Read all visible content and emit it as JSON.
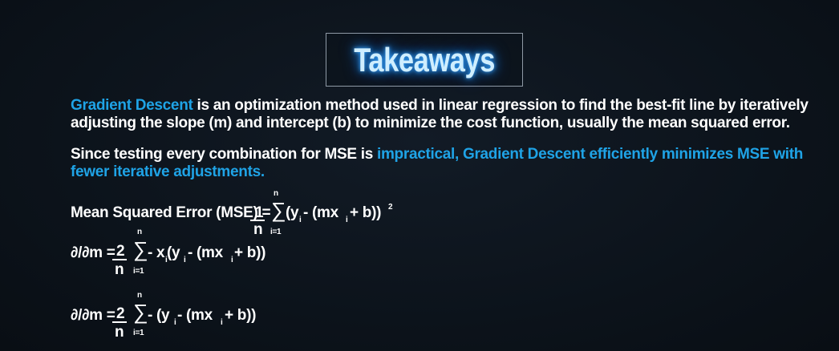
{
  "title": "Takeaways",
  "para1": {
    "highlight": "Gradient Descent",
    "rest": " is an optimization method used in linear regression to find the best-fit line by iteratively adjusting the slope (m) and intercept (b) to minimize the cost function, usually the mean squared error."
  },
  "para2": {
    "lead": "Since testing every combination for MSE is ",
    "highlight": "impractical, Gradient Descent efficiently minimizes MSE with fewer iterative adjustments."
  },
  "mse": {
    "label": "Mean Squared Error (MSE) =",
    "numerator": "1",
    "denominator": "n",
    "sum_top": "n",
    "sum_bottom": "i=1",
    "sigma": "∑",
    "body_open": "(y",
    "sub_i1": "i",
    "body_mid": " - (mx",
    "sub_i2": "i",
    "body_close": " + b))",
    "power": "2"
  },
  "deriv_m": {
    "label": "∂/∂m =",
    "numerator": "2",
    "denominator": "n",
    "sum_top": "n",
    "sum_bottom": "i=1",
    "sigma": "∑",
    "body_a": "- x",
    "sub_a": "i",
    "body_b": " (y",
    "sub_b": "i",
    "body_c": " - (mx",
    "sub_c": "i",
    "body_d": " + b))"
  },
  "deriv_b": {
    "label": "∂/∂m =",
    "numerator": "2",
    "denominator": "n",
    "sum_top": "n",
    "sum_bottom": "i=1",
    "sigma": "∑",
    "body_a": "- (y",
    "sub_a": "i",
    "body_b": " - (mx",
    "sub_b": "i",
    "body_c": " + b))"
  }
}
